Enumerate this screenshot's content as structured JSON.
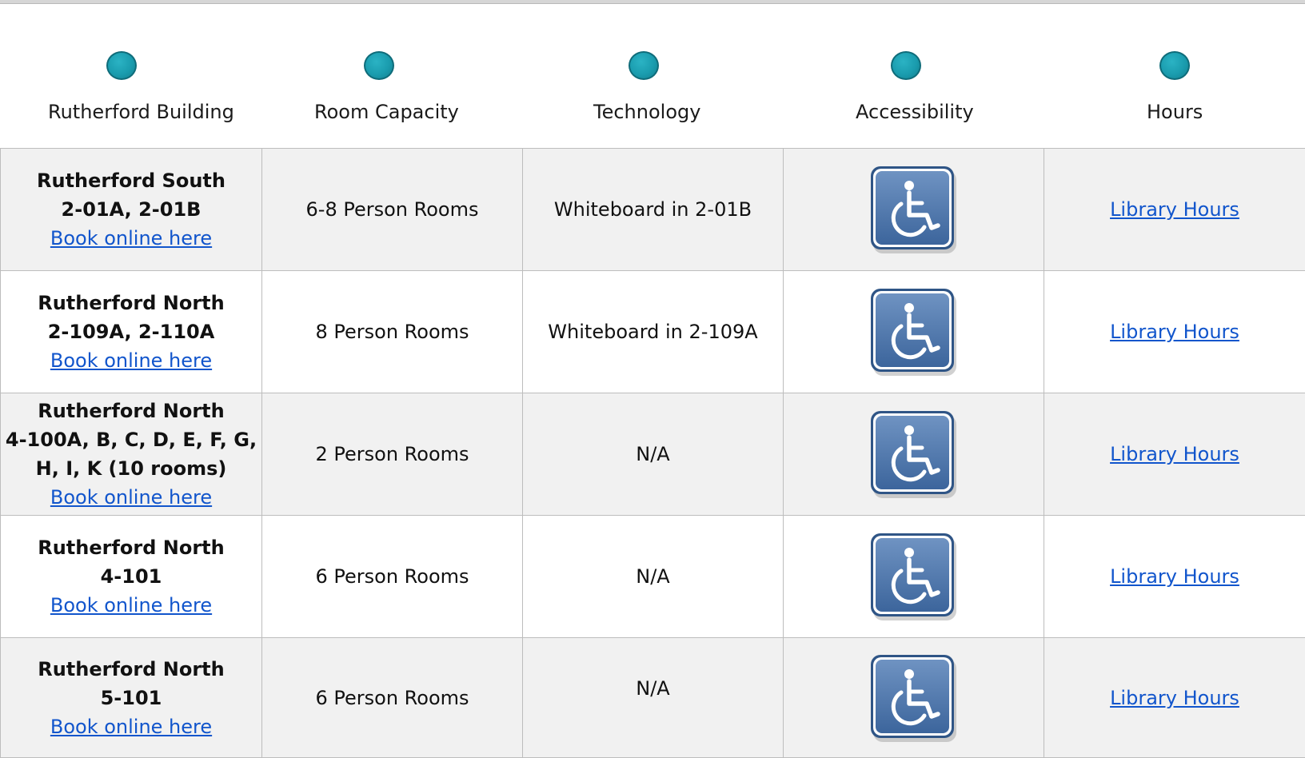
{
  "header": {
    "columns": [
      {
        "label": "Rutherford Building"
      },
      {
        "label": "Room Capacity"
      },
      {
        "label": "Technology"
      },
      {
        "label": "Accessibility"
      },
      {
        "label": "Hours"
      }
    ],
    "dot_color": "#1a9cae"
  },
  "rows": [
    {
      "building_lines": [
        "Rutherford South",
        "2-01A, 2-01B"
      ],
      "book_link": "Book online here",
      "capacity": "6-8 Person Rooms",
      "technology": "Whiteboard in 2-01B",
      "accessibility_icon": "wheelchair-accessible-icon",
      "hours_link": "Library Hours"
    },
    {
      "building_lines": [
        "Rutherford North",
        "2-109A, 2-110A"
      ],
      "book_link": "Book online here",
      "capacity": "8 Person Rooms",
      "technology": "Whiteboard in 2-109A",
      "accessibility_icon": "wheelchair-accessible-icon",
      "hours_link": "Library Hours"
    },
    {
      "building_lines": [
        "Rutherford North",
        "4-100A, B, C, D, E, F, G,",
        "H, I, K (10 rooms)"
      ],
      "book_link": "Book online here",
      "capacity": "2 Person Rooms",
      "technology": "N/A",
      "accessibility_icon": "wheelchair-accessible-icon",
      "hours_link": "Library Hours"
    },
    {
      "building_lines": [
        "Rutherford North",
        "4-101"
      ],
      "book_link": "Book online here",
      "capacity": "6 Person Rooms",
      "technology": "N/A",
      "accessibility_icon": "wheelchair-accessible-icon",
      "hours_link": "Library Hours"
    },
    {
      "building_lines": [
        "Rutherford North",
        "5-101"
      ],
      "book_link": "Book online here",
      "capacity": "6 Person Rooms",
      "technology": "N/A",
      "accessibility_icon": "wheelchair-accessible-icon",
      "hours_link": "Library Hours"
    }
  ],
  "colors": {
    "link": "#1155cc",
    "row_shade": "#f1f1f1",
    "border": "#bdbdbd",
    "icon_blue": "#4a72a6"
  }
}
